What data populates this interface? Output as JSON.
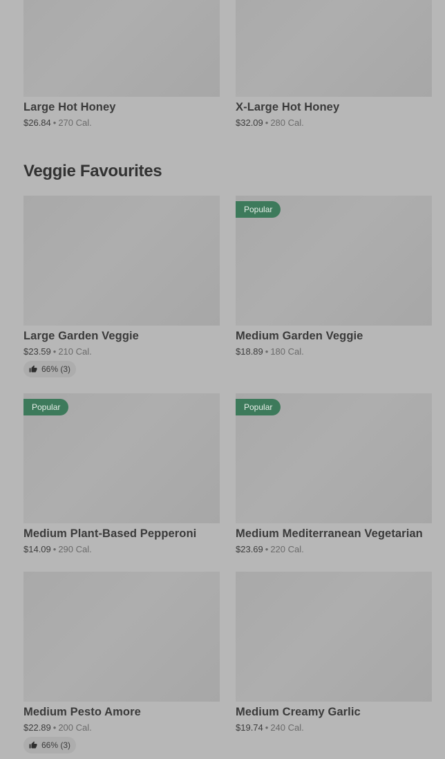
{
  "section": {
    "title": "Veggie Favourites"
  },
  "separator": "•",
  "items": [
    {
      "name": "Large Hot Honey",
      "price": "$26.84",
      "calories": "270 Cal."
    },
    {
      "name": "X-Large Hot Honey",
      "price": "$32.09",
      "calories": "280 Cal."
    },
    {
      "name": "Large Garden Veggie",
      "price": "$23.59",
      "calories": "210 Cal.",
      "rating": "66% (3)"
    },
    {
      "name": "Medium Garden Veggie",
      "price": "$18.89",
      "calories": "180 Cal.",
      "badge": "Popular"
    },
    {
      "name": "Medium Plant-Based Pepperoni",
      "price": "$14.09",
      "calories": "290 Cal.",
      "badge": "Popular"
    },
    {
      "name": "Medium Mediterranean Vegetarian",
      "price": "$23.69",
      "calories": "220 Cal.",
      "badge": "Popular"
    },
    {
      "name": "Medium Pesto Amore",
      "price": "$22.89",
      "calories": "200 Cal.",
      "rating": "66% (3)"
    },
    {
      "name": "Medium Creamy Garlic",
      "price": "$19.74",
      "calories": "240 Cal."
    }
  ],
  "colors": {
    "background": "#b7b7b7",
    "placeholder": "#aaaaaa",
    "badge": "#3d7a5b"
  },
  "icons": {
    "rating": "thumbs-up-icon"
  }
}
